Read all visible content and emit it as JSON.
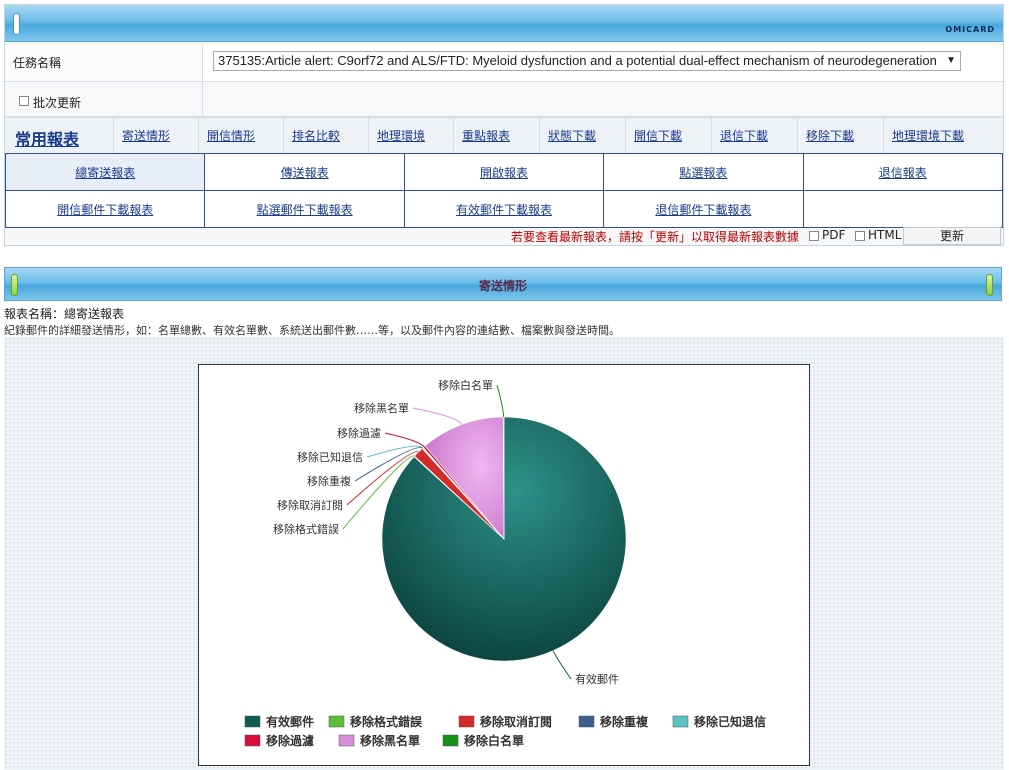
{
  "header": {
    "brand": "OMICARD"
  },
  "task": {
    "label": "任務名稱",
    "selected": "375135:Article alert: C9orf72 and ALS/FTD: Myeloid dysfunction and a potential dual-effect mechanism of neurodegeneration"
  },
  "batch": {
    "label": "批次更新"
  },
  "nav": {
    "title": "常用報表",
    "items": [
      "寄送情形",
      "開信情形",
      "排名比較",
      "地理環境",
      "重點報表",
      "狀態下載",
      "開信下載",
      "退信下載",
      "移除下載",
      "地理環境下載"
    ]
  },
  "reports": {
    "row1": [
      "總寄送報表",
      "傳送報表",
      "開啟報表",
      "點選報表",
      "退信報表"
    ],
    "row2": [
      "開信郵件下載報表",
      "點選郵件下載報表",
      "有效郵件下載報表",
      "退信郵件下載報表"
    ]
  },
  "footer": {
    "notice": "若要查看最新報表，請按「更新」以取得最新報表數據",
    "pdf": "PDF",
    "html": "HTML",
    "refresh": "更新"
  },
  "section": {
    "title": "寄送情形",
    "report_name": "報表名稱：總寄送報表",
    "description": "紀錄郵件的詳細發送情形，如：名單總數、有效名單數、系統送出郵件數……等，以及郵件內容的連結數、檔案數與發送時間。"
  },
  "chart_data": {
    "type": "pie",
    "slices": [
      {
        "name": "有效郵件",
        "value": 86.8,
        "color": "#0f5a54"
      },
      {
        "name": "移除格式錯誤",
        "value": 0.1,
        "color": "#5bbf3a"
      },
      {
        "name": "移除取消訂閱",
        "value": 1.4,
        "color": "#d42a2a"
      },
      {
        "name": "移除重複",
        "value": 0.1,
        "color": "#3d5e8c"
      },
      {
        "name": "移除已知退信",
        "value": 0.1,
        "color": "#5cc2c2"
      },
      {
        "name": "移除過濾",
        "value": 0.3,
        "color": "#d80f3c"
      },
      {
        "name": "移除黑名單",
        "value": 11.1,
        "color": "#d98fd9"
      },
      {
        "name": "移除白名單",
        "value": 0.1,
        "color": "#1a8f1a"
      }
    ],
    "legend": "bottom"
  }
}
